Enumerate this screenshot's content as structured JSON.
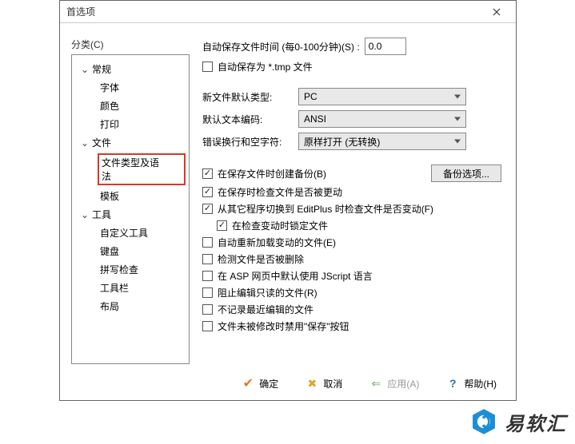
{
  "titlebar": {
    "title": "首选项"
  },
  "sidebar": {
    "label": "分类(C)",
    "items": [
      {
        "label": "常规",
        "level": 1,
        "expanded": true
      },
      {
        "label": "字体",
        "level": 2
      },
      {
        "label": "颜色",
        "level": 2
      },
      {
        "label": "打印",
        "level": 2
      },
      {
        "label": "文件",
        "level": 1,
        "expanded": true
      },
      {
        "label": "文件类型及语法",
        "level": 2,
        "highlighted": true
      },
      {
        "label": "模板",
        "level": 2
      },
      {
        "label": "工具",
        "level": 1,
        "expanded": true
      },
      {
        "label": "自定义工具",
        "level": 2
      },
      {
        "label": "键盘",
        "level": 2
      },
      {
        "label": "拼写检查",
        "level": 2
      },
      {
        "label": "工具栏",
        "level": 2
      },
      {
        "label": "布局",
        "level": 2
      }
    ]
  },
  "main": {
    "autosave": {
      "label": "自动保存文件时间 (每0-100分钟)(S) :",
      "value": "0.0"
    },
    "autosave_tmp": {
      "label": "自动保存为 *.tmp 文件",
      "checked": false
    },
    "default_type": {
      "label": "新文件默认类型:",
      "value": "PC"
    },
    "default_encoding": {
      "label": "默认文本编码:",
      "value": "ANSI"
    },
    "linebreak_ws": {
      "label": "错误换行和空字符:",
      "value": "原样打开 (无转换)"
    },
    "backup_on_save": {
      "label": "在保存文件时创建备份(B)",
      "checked": true
    },
    "backup_button": "备份选项...",
    "check_modified_on_save": {
      "label": "在保存时检查文件是否被更动",
      "checked": true
    },
    "check_modified_on_switch": {
      "label": "从其它程序切换到 EditPlus 时检查文件是否变动(F)",
      "checked": true
    },
    "lock_on_check": {
      "label": "在检查变动时锁定文件",
      "checked": true
    },
    "auto_reload": {
      "label": "自动重新加载变动的文件(E)",
      "checked": false
    },
    "detect_deleted": {
      "label": "检测文件是否被删除",
      "checked": false
    },
    "asp_jscript": {
      "label": "在 ASP 网页中默认使用 JScript 语言",
      "checked": false
    },
    "prevent_readonly_edit": {
      "label": "阻止编辑只读的文件(R)",
      "checked": false
    },
    "no_record_recent": {
      "label": "不记录最近编辑的文件",
      "checked": false
    },
    "disable_save_if_unmodified": {
      "label": "文件未被修改时禁用\"保存\"按钮",
      "checked": false
    }
  },
  "buttons": {
    "ok": "确定",
    "cancel": "取消",
    "apply": "应用(A)",
    "help": "帮助(H)"
  },
  "watermark": {
    "text": "易软汇"
  }
}
